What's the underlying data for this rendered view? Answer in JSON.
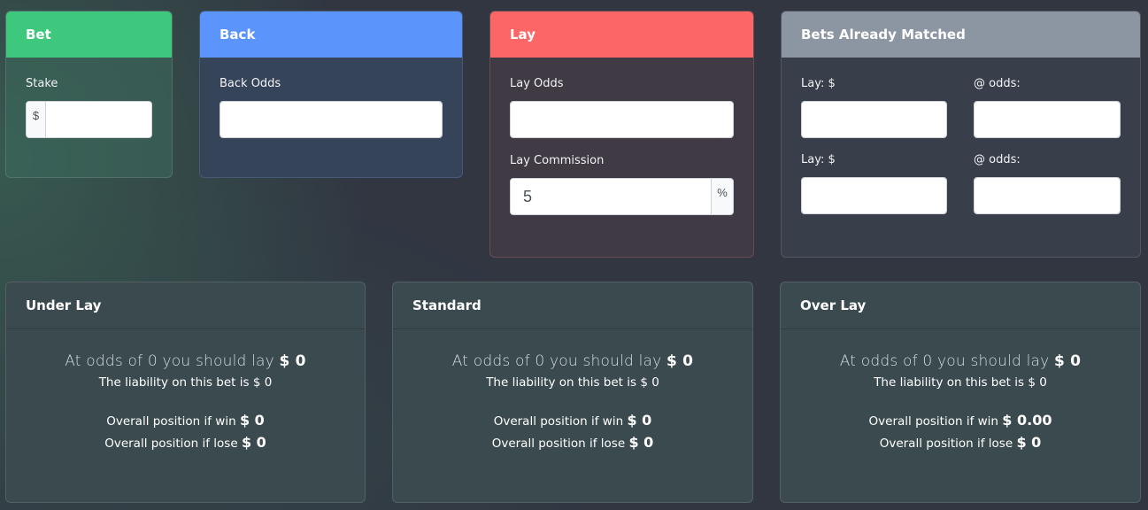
{
  "bet": {
    "title": "Bet",
    "stake_label": "Stake",
    "stake_prefix": "$",
    "stake_value": "",
    "color": "#3ec87d"
  },
  "back": {
    "title": "Back",
    "odds_label": "Back Odds",
    "odds_value": "",
    "color": "#5b95fb"
  },
  "lay": {
    "title": "Lay",
    "odds_label": "Lay Odds",
    "odds_value": "",
    "commission_label": "Lay Commission",
    "commission_value": "5",
    "commission_suffix": "%",
    "color": "#fc6667"
  },
  "matched": {
    "title": "Bets Already Matched",
    "color": "#8c96a2",
    "rows": [
      {
        "lay_label": "Lay: $",
        "lay_value": "",
        "odds_label": "@ odds:",
        "odds_value": ""
      },
      {
        "lay_label": "Lay: $",
        "lay_value": "",
        "odds_label": "@ odds:",
        "odds_value": ""
      }
    ]
  },
  "results": [
    {
      "title": "Under Lay",
      "odds_prefix": "At odds of",
      "odds": "0",
      "lay_text": "you should lay",
      "lay_amount": "$ 0",
      "liability_text": "The liability on this bet is $ 0",
      "win_label": "Overall position if win",
      "win_value": "$ 0",
      "lose_label": "Overall position if lose",
      "lose_value": "$ 0"
    },
    {
      "title": "Standard",
      "odds_prefix": "At odds of",
      "odds": "0",
      "lay_text": "you should lay",
      "lay_amount": "$ 0",
      "liability_text": "The liability on this bet is $ 0",
      "win_label": "Overall position if win",
      "win_value": "$ 0",
      "lose_label": "Overall position if lose",
      "lose_value": "$ 0"
    },
    {
      "title": "Over Lay",
      "odds_prefix": "At odds of",
      "odds": "0",
      "lay_text": "you should lay",
      "lay_amount": "$ 0",
      "liability_text": "The liability on this bet is $ 0",
      "win_label": "Overall position if win",
      "win_value": "$ 0.00",
      "lose_label": "Overall position if lose",
      "lose_value": "$ 0"
    }
  ]
}
